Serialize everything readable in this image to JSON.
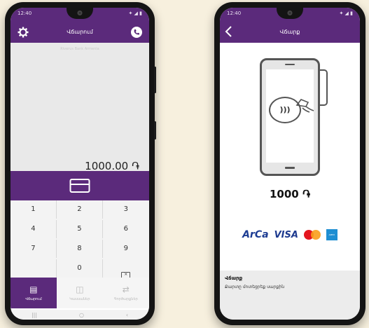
{
  "left_phone": {
    "status_time": "12:40",
    "status_right": "✦ ◢ ▮",
    "title": "Վճարում",
    "settings_icon": "gear-icon",
    "phone_icon": "phone-icon",
    "watermark": "Riverus Bank Armenia",
    "amount": "1000.00 ֏",
    "keys": [
      "1",
      "2",
      "3",
      "4",
      "5",
      "6",
      "7",
      "8",
      "9",
      "",
      "0",
      ""
    ],
    "tabs": [
      {
        "label": "Վճարում",
        "icon": "terminal-icon"
      },
      {
        "label": "Կասսաներ",
        "icon": "wallet-icon"
      },
      {
        "label": "Գործարքներ",
        "icon": "transfer-icon"
      }
    ],
    "nav": {
      "recents": "|||",
      "home": "○",
      "back": "‹"
    }
  },
  "right_phone": {
    "status_time": "12:40",
    "status_right": "✦ ◢ ▮",
    "title": "Վճարք",
    "amount": "1000 ֏",
    "brands": {
      "arca": "ArCa",
      "visa": "VISA",
      "amex": "AMEX"
    },
    "sheet_title": "Վճարք",
    "sheet_subtitle": "Քարտը մոտեցրեք սարքին"
  },
  "colors": {
    "brand": "#5b2a7b",
    "background": "#f7f0de"
  }
}
